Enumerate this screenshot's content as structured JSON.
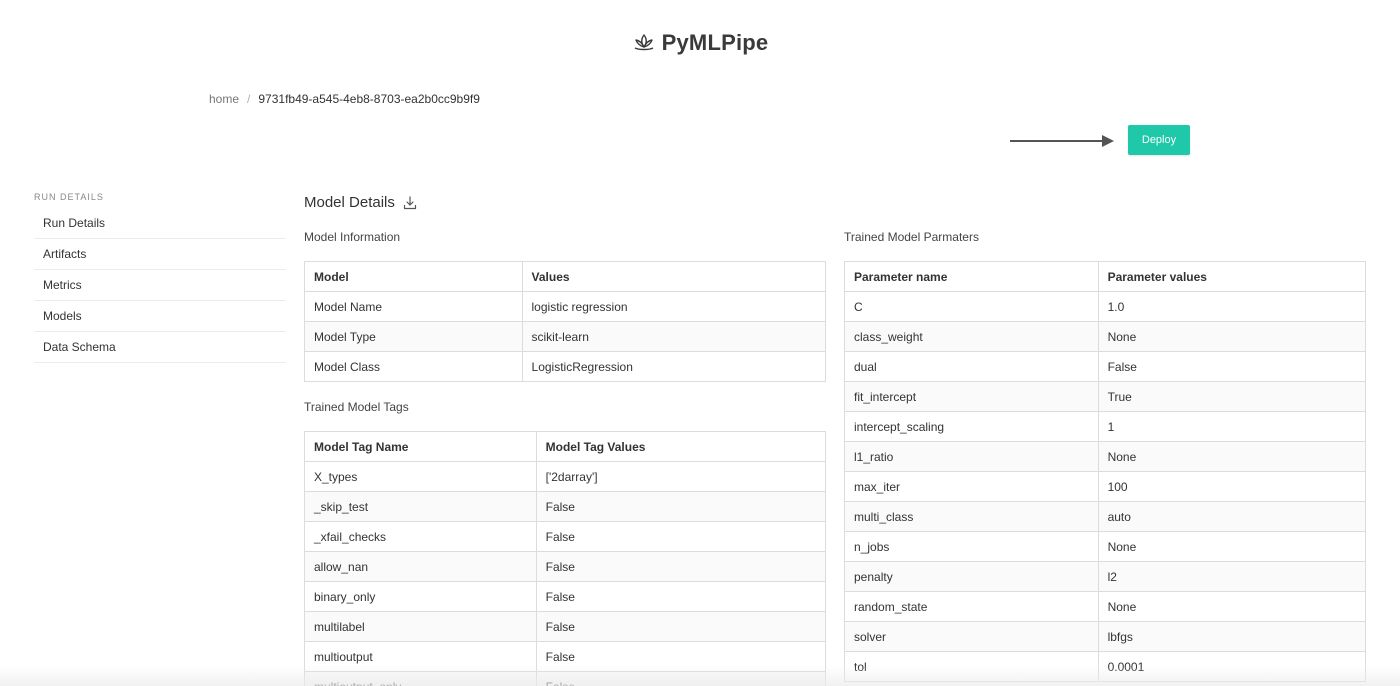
{
  "brand": {
    "title": "PyMLPipe",
    "icon": "lotus-icon"
  },
  "breadcrumb": {
    "home": "home",
    "separator": "/",
    "current": "9731fb49-a545-4eb8-8703-ea2b0cc9b9f9"
  },
  "deploy": {
    "label": "Deploy",
    "color": "#1fc8a9"
  },
  "sidebar": {
    "heading": "RUN DETAILS",
    "items": [
      {
        "label": "Run Details"
      },
      {
        "label": "Artifacts"
      },
      {
        "label": "Metrics"
      },
      {
        "label": "Models"
      },
      {
        "label": "Data Schema"
      }
    ]
  },
  "main": {
    "title": "Model Details",
    "download_icon": "download-icon",
    "model_info": {
      "label": "Model Information",
      "headers": [
        "Model",
        "Values"
      ],
      "rows": [
        [
          "Model Name",
          "logistic regression"
        ],
        [
          "Model Type",
          "scikit-learn"
        ],
        [
          "Model Class",
          "LogisticRegression"
        ]
      ]
    },
    "model_tags": {
      "label": "Trained Model Tags",
      "headers": [
        "Model Tag Name",
        "Model Tag Values"
      ],
      "rows": [
        [
          "X_types",
          "['2darray']"
        ],
        [
          "_skip_test",
          "False"
        ],
        [
          "_xfail_checks",
          "False"
        ],
        [
          "allow_nan",
          "False"
        ],
        [
          "binary_only",
          "False"
        ],
        [
          "multilabel",
          "False"
        ],
        [
          "multioutput",
          "False"
        ],
        [
          "multioutput_only",
          "False"
        ]
      ]
    },
    "model_params": {
      "label": "Trained Model Parmaters",
      "headers": [
        "Parameter name",
        "Parameter values"
      ],
      "rows": [
        [
          "C",
          "1.0"
        ],
        [
          "class_weight",
          "None"
        ],
        [
          "dual",
          "False"
        ],
        [
          "fit_intercept",
          "True"
        ],
        [
          "intercept_scaling",
          "1"
        ],
        [
          "l1_ratio",
          "None"
        ],
        [
          "max_iter",
          "100"
        ],
        [
          "multi_class",
          "auto"
        ],
        [
          "n_jobs",
          "None"
        ],
        [
          "penalty",
          "l2"
        ],
        [
          "random_state",
          "None"
        ],
        [
          "solver",
          "lbfgs"
        ],
        [
          "tol",
          "0.0001"
        ]
      ]
    }
  }
}
